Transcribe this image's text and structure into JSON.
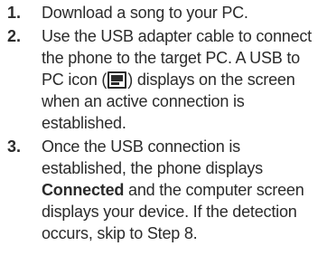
{
  "steps": [
    {
      "number": "1.",
      "text": "Download a song to your PC."
    },
    {
      "number": "2.",
      "text_before_icon": "Use the USB adapter cable to connect the phone to the target PC. A USB to PC icon (",
      "icon": "usb-to-pc-icon",
      "text_after_icon": ") displays on the screen when an active connection is established."
    },
    {
      "number": "3.",
      "text_before_bold": "Once the USB connection is established, the phone displays ",
      "bold": "Connected",
      "text_after_bold": " and the computer screen displays your device. If the detection occurs, skip to Step 8."
    }
  ]
}
